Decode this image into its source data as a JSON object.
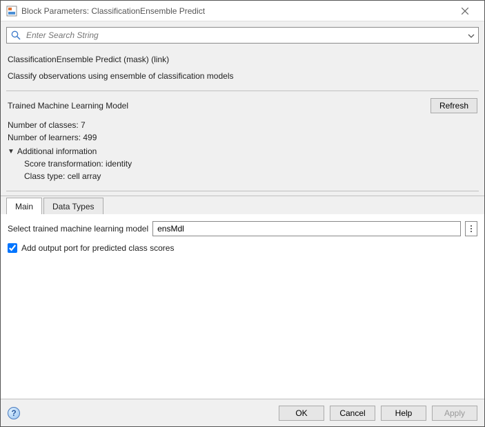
{
  "window": {
    "title": "Block Parameters: ClassificationEnsemble Predict"
  },
  "search": {
    "placeholder": "Enter Search String"
  },
  "mask": {
    "title": "ClassificationEnsemble Predict (mask) (link)",
    "description": "Classify observations using ensemble of classification models"
  },
  "model": {
    "section_title": "Trained Machine Learning Model",
    "refresh_label": "Refresh",
    "num_classes_label": "Number of classes: 7",
    "num_learners_label": "Number of learners: 499",
    "additional_label": "Additional information",
    "score_transformation": "Score transformation: identity",
    "class_type": "Class type: cell array"
  },
  "tabs": {
    "main": "Main",
    "datatypes": "Data Types"
  },
  "main": {
    "select_model_label": "Select trained machine learning model",
    "select_model_value": "ensMdl",
    "checkbox_label": "Add output port for predicted class scores"
  },
  "footer": {
    "ok": "OK",
    "cancel": "Cancel",
    "help": "Help",
    "apply": "Apply",
    "help_icon": "?"
  }
}
